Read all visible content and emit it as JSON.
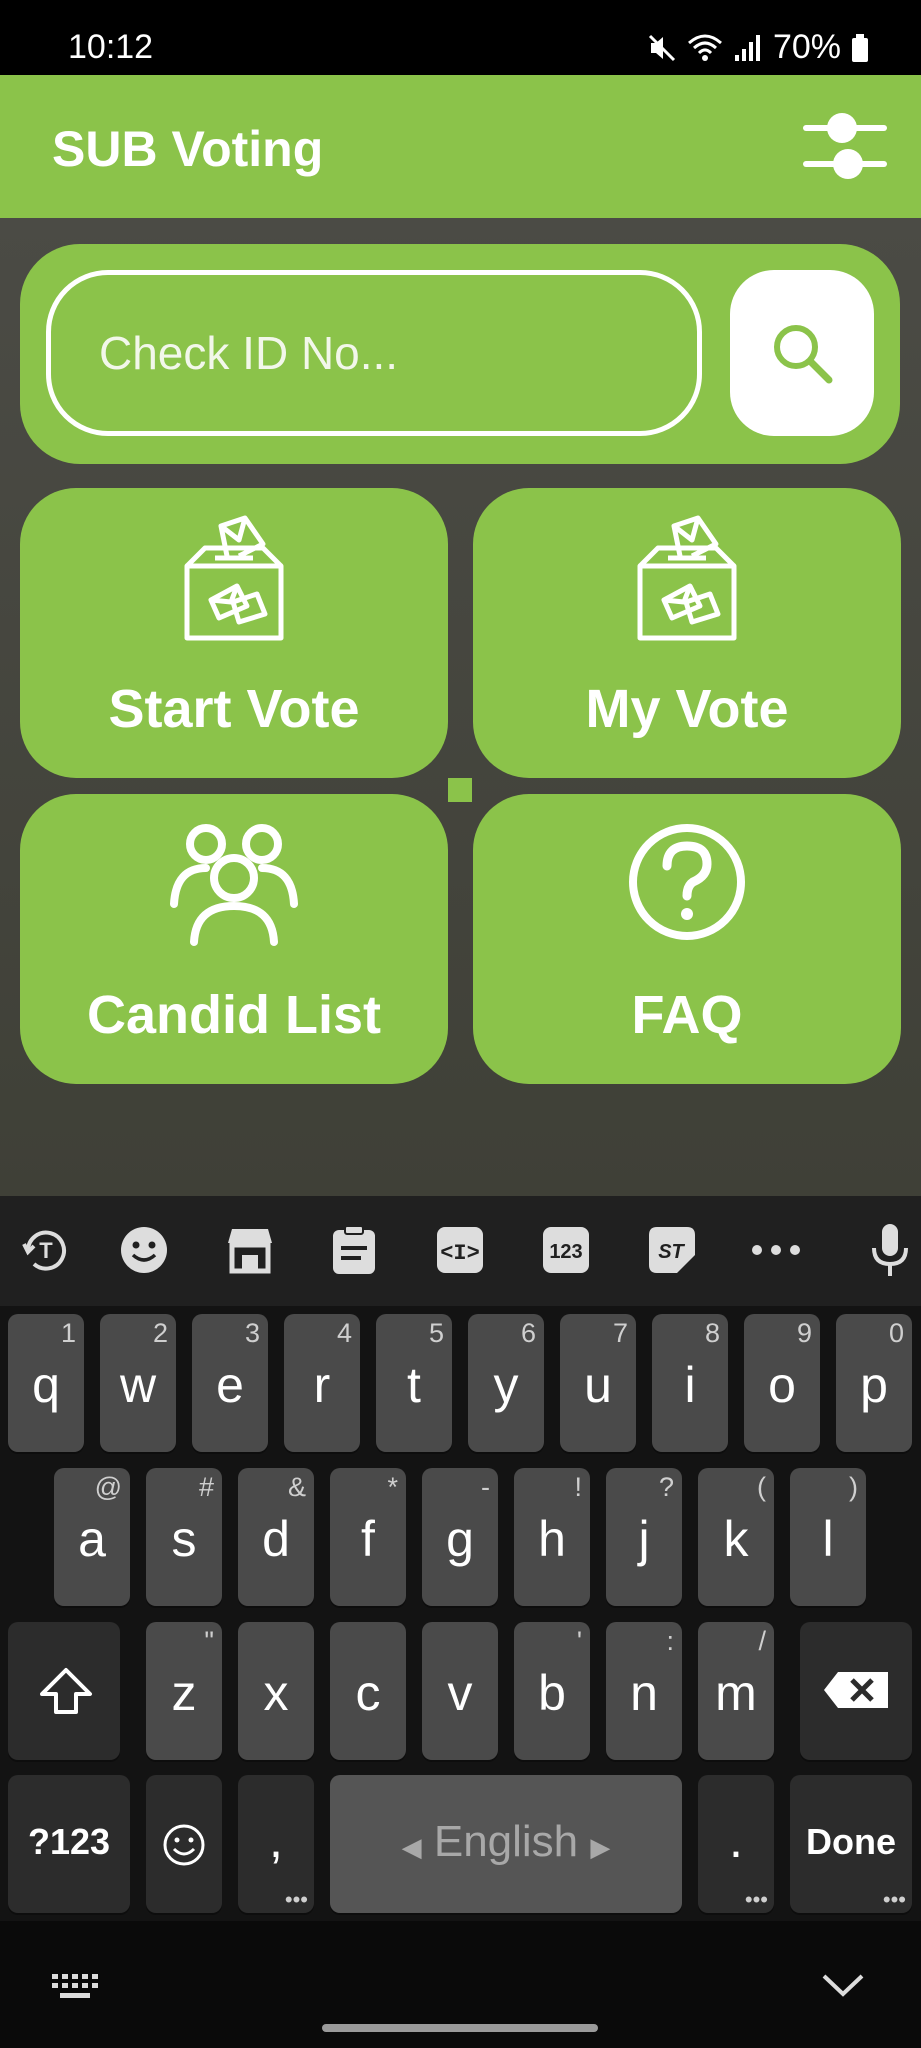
{
  "status_bar": {
    "time": "10:12",
    "battery": "70%"
  },
  "app": {
    "title": "SUB Voting"
  },
  "search": {
    "placeholder": "Check ID No..."
  },
  "tiles": [
    {
      "label": "Start Vote",
      "icon": "ballot-box-icon"
    },
    {
      "label": "My Vote",
      "icon": "ballot-box-icon"
    },
    {
      "label": "Candid List",
      "icon": "people-icon"
    },
    {
      "label": "FAQ",
      "icon": "question-circle-icon"
    }
  ],
  "keyboard": {
    "toolbar": [
      "translate-icon",
      "emoji-icon",
      "store-icon",
      "clipboard-icon",
      "text-edit-icon",
      "numpad-icon",
      "stickers-icon",
      "more-icon",
      "mic-icon"
    ],
    "numpad_label": "123",
    "row1": [
      {
        "k": "q",
        "s": "1"
      },
      {
        "k": "w",
        "s": "2"
      },
      {
        "k": "e",
        "s": "3"
      },
      {
        "k": "r",
        "s": "4"
      },
      {
        "k": "t",
        "s": "5"
      },
      {
        "k": "y",
        "s": "6"
      },
      {
        "k": "u",
        "s": "7"
      },
      {
        "k": "i",
        "s": "8"
      },
      {
        "k": "o",
        "s": "9"
      },
      {
        "k": "p",
        "s": "0"
      }
    ],
    "row2": [
      {
        "k": "a",
        "s": "@"
      },
      {
        "k": "s",
        "s": "#"
      },
      {
        "k": "d",
        "s": "&"
      },
      {
        "k": "f",
        "s": "*"
      },
      {
        "k": "g",
        "s": "-"
      },
      {
        "k": "h",
        "s": "!"
      },
      {
        "k": "j",
        "s": "?"
      },
      {
        "k": "k",
        "s": "("
      },
      {
        "k": "l",
        "s": ")"
      }
    ],
    "row3": [
      {
        "k": "z",
        "s": "\""
      },
      {
        "k": "x",
        "s": ""
      },
      {
        "k": "c",
        "s": ""
      },
      {
        "k": "v",
        "s": ""
      },
      {
        "k": "b",
        "s": "'"
      },
      {
        "k": "n",
        "s": ":"
      },
      {
        "k": "m",
        "s": "/"
      }
    ],
    "symbols_label": "?123",
    "comma": ",",
    "space_label": "English",
    "period": ".",
    "done_label": "Done"
  }
}
